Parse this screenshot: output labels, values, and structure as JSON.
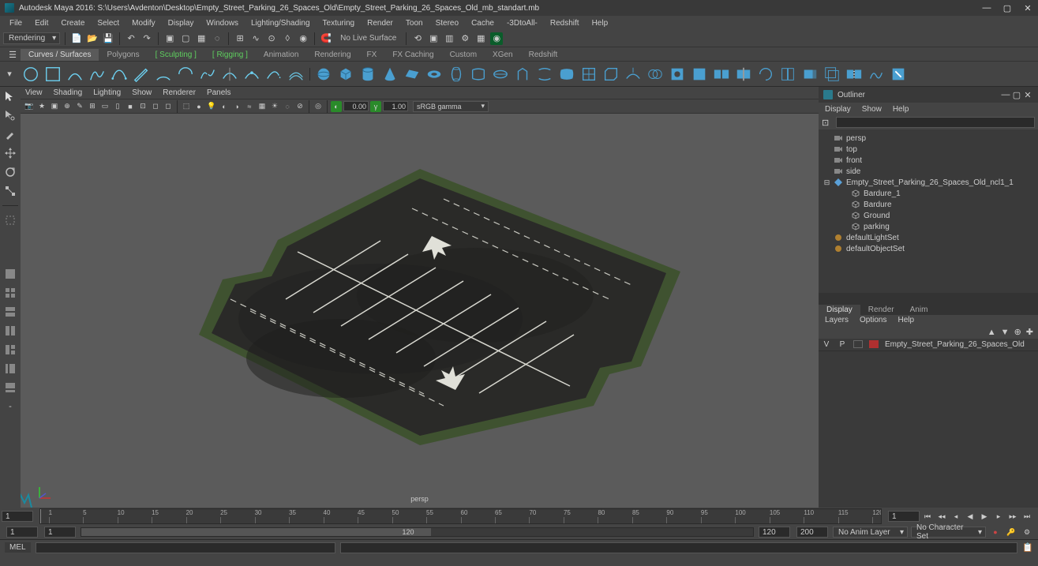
{
  "title": "Autodesk Maya 2016: S:\\Users\\Avdenton\\Desktop\\Empty_Street_Parking_26_Spaces_Old\\Empty_Street_Parking_26_Spaces_Old_mb_standart.mb",
  "menu": [
    "File",
    "Edit",
    "Create",
    "Select",
    "Modify",
    "Display",
    "Windows",
    "Lighting/Shading",
    "Texturing",
    "Render",
    "Toon",
    "Stereo",
    "Cache",
    "-3DtoAll-",
    "Redshift",
    "Help"
  ],
  "workspace_dd": "Rendering",
  "no_live": "No Live Surface",
  "shelf_tabs": [
    "Curves / Surfaces",
    "Polygons",
    "Sculpting",
    "Rigging",
    "Animation",
    "Rendering",
    "FX",
    "FX Caching",
    "Custom",
    "XGen",
    "Redshift"
  ],
  "panel_menu": [
    "View",
    "Shading",
    "Lighting",
    "Show",
    "Renderer",
    "Panels"
  ],
  "panel_field1": "0.00",
  "panel_field2": "1.00",
  "gamma_dd": "sRGB gamma",
  "viewport_label": "persp",
  "outliner": {
    "title": "Outliner",
    "menu": [
      "Display",
      "Show",
      "Help"
    ],
    "items": [
      {
        "icon": "cam",
        "label": "persp",
        "indent": 0
      },
      {
        "icon": "cam",
        "label": "top",
        "indent": 0
      },
      {
        "icon": "cam",
        "label": "front",
        "indent": 0
      },
      {
        "icon": "cam",
        "label": "side",
        "indent": 0
      },
      {
        "icon": "group",
        "label": "Empty_Street_Parking_26_Spaces_Old_ncl1_1",
        "indent": 0,
        "expanded": true
      },
      {
        "icon": "mesh",
        "label": "Bardure_1",
        "indent": 1
      },
      {
        "icon": "mesh",
        "label": "Bardure",
        "indent": 1
      },
      {
        "icon": "mesh",
        "label": "Ground",
        "indent": 1
      },
      {
        "icon": "mesh",
        "label": "parking",
        "indent": 1
      },
      {
        "icon": "set",
        "label": "defaultLightSet",
        "indent": 0
      },
      {
        "icon": "set",
        "label": "defaultObjectSet",
        "indent": 0
      }
    ]
  },
  "cbx": {
    "tabs": [
      "Display",
      "Render",
      "Anim"
    ],
    "menu": [
      "Layers",
      "Options",
      "Help"
    ],
    "layer_vis": "V",
    "layer_p": "P",
    "layer_name": "Empty_Street_Parking_26_Spaces_Old"
  },
  "timeline": {
    "ticks": [
      "1",
      "5",
      "10",
      "15",
      "20",
      "25",
      "30",
      "35",
      "40",
      "45",
      "50",
      "55",
      "60",
      "65",
      "70",
      "75",
      "80",
      "85",
      "90",
      "95",
      "100",
      "105",
      "110",
      "115",
      "120"
    ],
    "start_field": "1",
    "current_field": "1",
    "range_start": "1",
    "range_mid": "120",
    "range_end1": "120",
    "range_end2": "200",
    "anim_layer_dd": "No Anim Layer",
    "char_set_dd": "No Character Set"
  },
  "cmd_label": "MEL"
}
